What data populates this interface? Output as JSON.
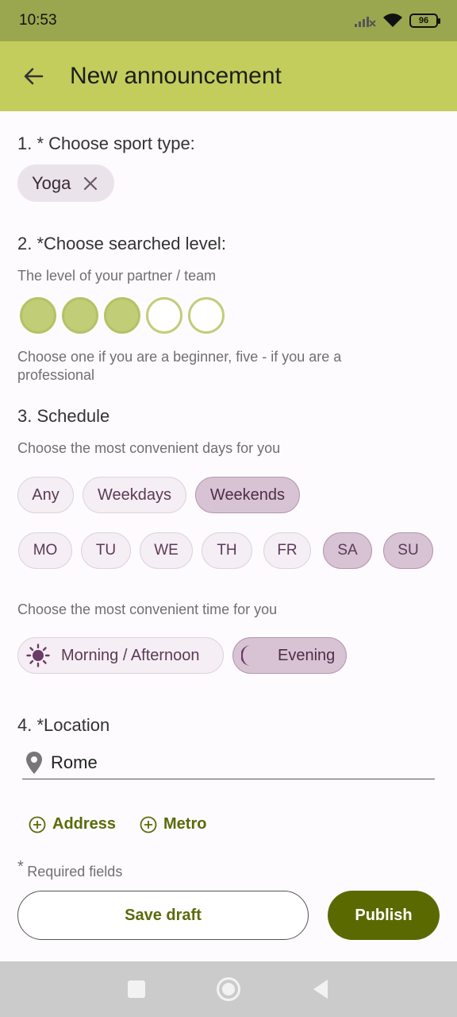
{
  "status_bar": {
    "time": "10:53",
    "battery": "96"
  },
  "app_bar": {
    "title": "New announcement"
  },
  "sport": {
    "title": "1. * Choose sport type:",
    "selected_chip": "Yoga"
  },
  "level": {
    "title": "2. *Choose searched level:",
    "subtitle": "The level of your partner / team",
    "selected_level": 3,
    "max_level": 5,
    "hint": "Choose one if you are a beginner, five - if you are a professional"
  },
  "schedule": {
    "title": "3. Schedule",
    "days_hint": "Choose the most convenient days for you",
    "presets": [
      {
        "label": "Any",
        "selected": false
      },
      {
        "label": "Weekdays",
        "selected": false
      },
      {
        "label": "Weekends",
        "selected": true
      }
    ],
    "days": [
      {
        "label": "MO",
        "selected": false
      },
      {
        "label": "TU",
        "selected": false
      },
      {
        "label": "WE",
        "selected": false
      },
      {
        "label": "TH",
        "selected": false
      },
      {
        "label": "FR",
        "selected": false
      },
      {
        "label": "SA",
        "selected": true
      },
      {
        "label": "SU",
        "selected": true
      }
    ],
    "time_hint": "Choose the most convenient time for you",
    "times": [
      {
        "label": "Morning / Afternoon",
        "icon": "sun-icon",
        "selected": false
      },
      {
        "label": "Evening",
        "icon": "moon-icon",
        "selected": true
      }
    ]
  },
  "location": {
    "title": "4. *Location",
    "value": "Rome",
    "add_address": "Address",
    "add_metro": "Metro"
  },
  "required_note": {
    "asterisk": "*",
    "text": "Required fields"
  },
  "actions": {
    "save_draft": "Save draft",
    "publish": "Publish"
  },
  "colors": {
    "app_bar": "#c2cd5c",
    "status_bar": "#9aa74f",
    "primary": "#5b6a00",
    "chip_selected": "#d8c3d4"
  }
}
